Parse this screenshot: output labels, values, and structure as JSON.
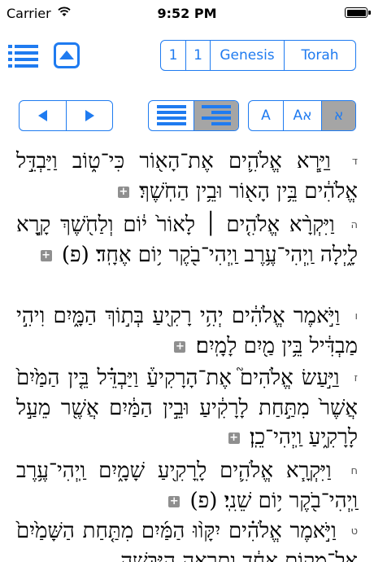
{
  "status": {
    "carrier": "Carrier",
    "time": "9:52 PM"
  },
  "nav": {
    "chapter": "1",
    "verse": "1",
    "book": "Genesis",
    "collection": "Torah"
  },
  "font_buttons": {
    "a1": "A",
    "a2": "Aא",
    "a3": "א"
  },
  "verses": [
    {
      "num": "",
      "text": "ה",
      "plus": false
    },
    {
      "num": "ד",
      "text": "וַיַּ֧רְא אֱלֹהִ֛ים אֶת־הָא֖וֹר כִּי־ט֑וֹב וַיַּבְדֵּ֣ל אֱלֹהִ֔ים בֵּ֥ין הָא֖וֹר וּבֵ֥ין הַחֹֽשֶׁךְ׃",
      "plus": true
    },
    {
      "num": "ה",
      "text": "וַיִּקְרָ֨א אֱלֹהִ֤ים ׀ לָאוֹר֙ י֔וֹם וְלַחֹ֖שֶׁךְ קָ֣רָא לָ֑יְלָה וַֽיְהִי־עֶ֥רֶב וַֽיְהִי־בֹ֖קֶר י֥וֹם אֶחָֽד׃ (פ)",
      "plus": true
    },
    {
      "num": "ו",
      "text": "וַיֹּ֣אמֶר אֱלֹהִ֔ים יְהִ֥י רָקִ֖יעַ בְּת֣וֹךְ הַמָּ֑יִם וִיהִ֣י מַבְדִּ֔יל בֵּ֥ין מַ֖יִם לָמָֽיִם׃",
      "plus": true
    },
    {
      "num": "ז",
      "text": "וַיַּ֣עַשׂ אֱלֹהִים֮ אֶת־הָרָקִיעַ֒ וַיַּבְדֵּ֗ל בֵּ֤ין הַמַּ֙יִם֙ אֲשֶׁר֙ מִתַּ֣חַת לָרָקִ֔יעַ וּבֵ֣ין הַמַּ֔יִם אֲשֶׁ֖ר מֵעַ֣ל לָרָקִ֑יעַ וַֽיְהִי־כֵֽן׃",
      "plus": true
    },
    {
      "num": "ח",
      "text": "וַיִּקְרָ֧א אֱלֹהִ֛ים לָֽרָקִ֖יעַ שָׁמָ֑יִם וַֽיְהִי־עֶ֥רֶב וַֽיְהִי־בֹ֖קֶר י֥וֹם שֵׁנִֽי׃ (פ)",
      "plus": true
    },
    {
      "num": "ט",
      "text": "וַיֹּ֣אמֶר אֱלֹהִ֗ים יִקָּו֨וּ הַמַּ֜יִם מִתַּ֤חַת הַשָּׁמַ֙יִם֙ אֶל־מָק֣וֹם אֶחָ֔ד וְתֵרָאֶ֖ה הַיַּבָּשָׁ֑ה",
      "plus": false
    }
  ],
  "colors": {
    "accent": "#1f7bf0",
    "selected": "#a5a5a5"
  }
}
